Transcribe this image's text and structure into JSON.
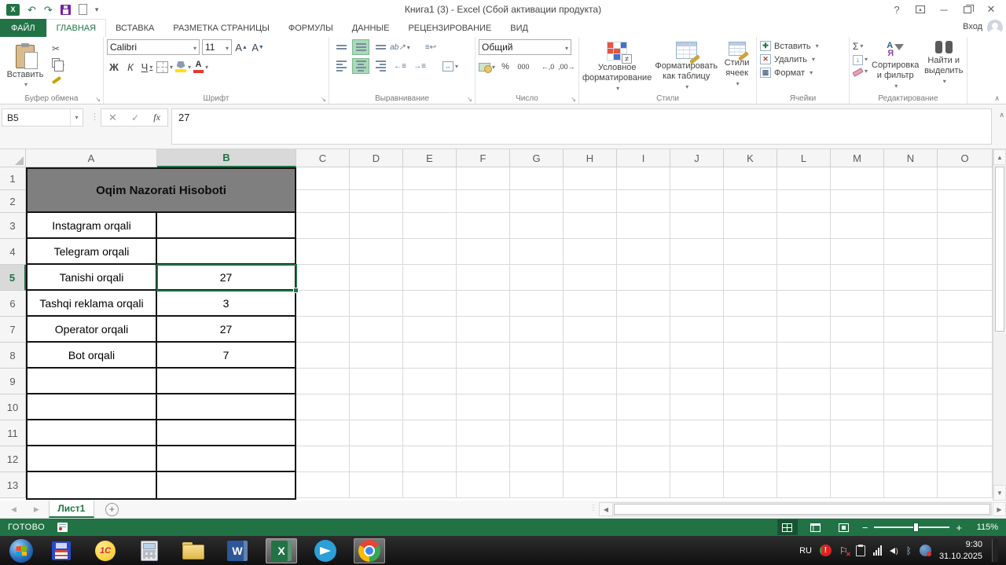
{
  "titlebar": {
    "title": "Книга1 (3) - Excel (Сбой активации продукта)",
    "help_glyph": "?"
  },
  "account": {
    "sign_in": "Вход"
  },
  "tabs": [
    {
      "label": "ФАЙЛ"
    },
    {
      "label": "ГЛАВНАЯ"
    },
    {
      "label": "ВСТАВКА"
    },
    {
      "label": "РАЗМЕТКА СТРАНИЦЫ"
    },
    {
      "label": "ФОРМУЛЫ"
    },
    {
      "label": "ДАННЫЕ"
    },
    {
      "label": "РЕЦЕНЗИРОВАНИЕ"
    },
    {
      "label": "ВИД"
    }
  ],
  "ribbon": {
    "clipboard": {
      "label": "Буфер обмена",
      "paste": "Вставить"
    },
    "font": {
      "label": "Шрифт",
      "name": "Calibri",
      "size": "11",
      "bold": "Ж",
      "italic": "К",
      "underline": "Ч"
    },
    "alignment": {
      "label": "Выравнивание"
    },
    "number": {
      "label": "Число",
      "format": "Общий",
      "percent": "%",
      "thousands": "000",
      "inc_decimal": "←,0",
      "dec_decimal": ",00→"
    },
    "styles": {
      "label": "Стили",
      "conditional": "Условное форматирование",
      "format_table": "Форматировать как таблицу",
      "cell_styles": "Стили ячеек"
    },
    "cells": {
      "label": "Ячейки",
      "insert": "Вставить",
      "delete": "Удалить",
      "format": "Формат"
    },
    "editing": {
      "label": "Редактирование",
      "sum": "Σ",
      "sort_filter": "Сортировка и фильтр",
      "find_select": "Найти и выделить"
    }
  },
  "formula_bar": {
    "name_box": "B5",
    "fx": "fx",
    "value": "27"
  },
  "grid": {
    "columns": [
      "A",
      "B",
      "C",
      "D",
      "E",
      "F",
      "G",
      "H",
      "I",
      "J",
      "K",
      "L",
      "M",
      "N",
      "O"
    ],
    "rows": [
      1,
      2,
      3,
      4,
      5,
      6,
      7,
      8,
      9,
      10,
      11,
      12,
      13
    ],
    "merged_title": "Oqim Nazorati Hisoboti",
    "selection": {
      "cell": "B5",
      "column": "B",
      "row": 5
    },
    "table_rows": [
      {
        "row": 3,
        "label": "Instagram orqali",
        "value": ""
      },
      {
        "row": 4,
        "label": "Telegram orqali",
        "value": ""
      },
      {
        "row": 5,
        "label": "Tanishi orqali",
        "value": "27"
      },
      {
        "row": 6,
        "label": "Tashqi reklama orqali",
        "value": "3"
      },
      {
        "row": 7,
        "label": "Operator orqali",
        "value": "27"
      },
      {
        "row": 8,
        "label": "Bot orqali",
        "value": "7"
      }
    ],
    "table_last_row": 13
  },
  "sheet_bar": {
    "tab": "Лист1",
    "add": "+"
  },
  "status_bar": {
    "mode": "ГОТОВО",
    "zoom": "115%",
    "zoom_out": "−",
    "zoom_in": "+"
  },
  "taskbar": {
    "one_c": "1С",
    "word": "W",
    "excel": "X",
    "tray": {
      "language": "RU",
      "time": "9:30",
      "date": "31.10.2025"
    }
  },
  "colors": {
    "excel_green": "#217346",
    "title_cell_gray": "#7f7f7f",
    "fill_color_swatch": "#ffe100",
    "font_color_swatch": "#e03c31",
    "selection_border": "#217346"
  }
}
